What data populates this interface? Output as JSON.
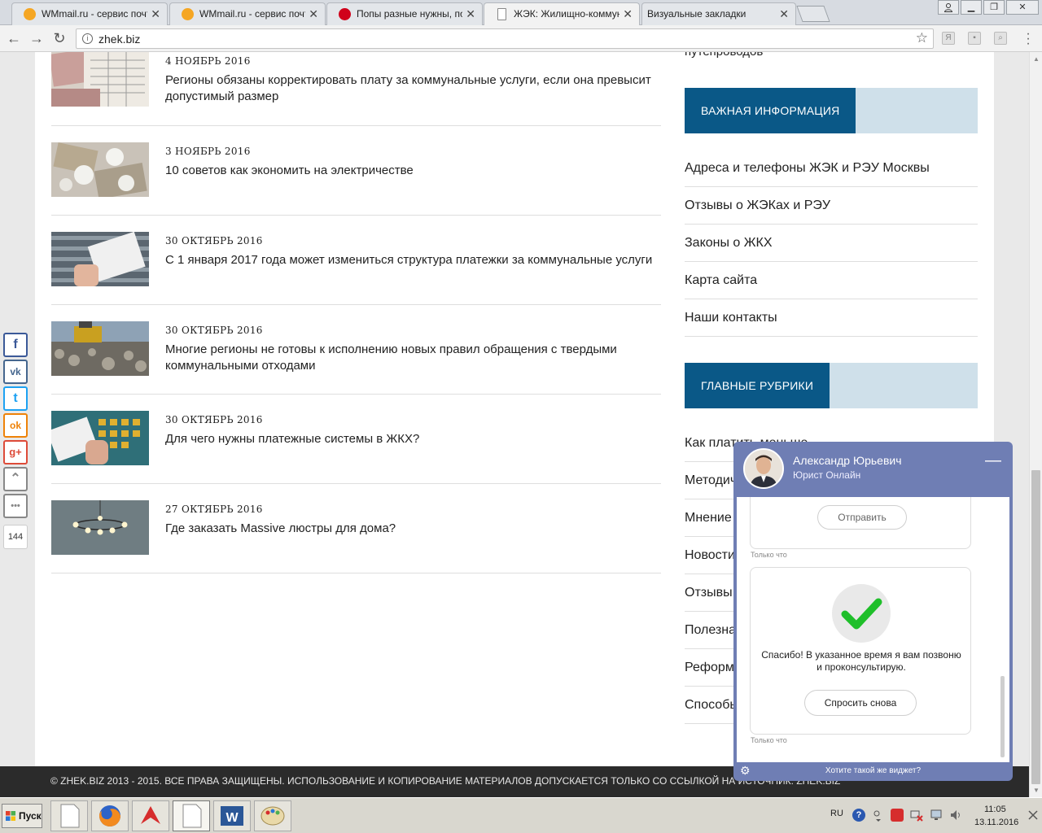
{
  "browser": {
    "tabs": [
      {
        "title": "WMmail.ru - сервис почтов",
        "favicon_color": "#f5a623"
      },
      {
        "title": "WMmail.ru - сервис почтов",
        "favicon_color": "#f5a623"
      },
      {
        "title": "Попы разные нужны, поп",
        "favicon_color": "#d0021b"
      },
      {
        "title": "ЖЭК: Жилищно-коммунал",
        "favicon_color": "#ffffff"
      },
      {
        "title": "Визуальные закладки",
        "favicon_color": "#e3e6ea"
      }
    ],
    "close_glyph": "✕",
    "url": "zhek.biz"
  },
  "news": [
    {
      "date": "4 НОЯБРЬ 2016",
      "title": "Регионы обязаны корректировать плату за коммунальные услуги, если она превысит допустимый размер"
    },
    {
      "date": "3 НОЯБРЬ 2016",
      "title": "10 советов как экономить на электричестве"
    },
    {
      "date": "30 ОКТЯБРЬ 2016",
      "title": "С 1 января 2017 года может измениться структура платежки за коммунальные услуги"
    },
    {
      "date": "30 ОКТЯБРЬ 2016",
      "title": "Многие регионы не готовы к исполнению новых правил обращения с твердыми коммунальными отходами"
    },
    {
      "date": "30 ОКТЯБРЬ 2016",
      "title": "Для чего нужны платежные системы в ЖКХ?"
    },
    {
      "date": "27 ОКТЯБРЬ 2016",
      "title": "Где заказать Massive люстры для дома?"
    }
  ],
  "sidebar": {
    "cut_text": "путепроводов",
    "important": {
      "heading": "ВАЖНАЯ ИНФОРМАЦИЯ",
      "links": [
        "Адреса и телефоны ЖЭК и РЭУ Москвы",
        "Отзывы о ЖЭКах и РЭУ",
        "Законы о ЖКХ",
        "Карта сайта",
        "Наши контакты"
      ]
    },
    "rubrics": {
      "heading": "ГЛАВНЫЕ РУБРИКИ",
      "links": [
        "Как платить меньше",
        "Методич",
        "Мнение",
        "Новости",
        "Отзывы",
        "Полезна",
        "Реформ",
        "Способы"
      ]
    }
  },
  "footer": {
    "text": "© ZHEK.BIZ 2013 - 2015. ВСЕ ПРАВА ЗАЩИЩЕНЫ. ИСПОЛЬЗОВАНИЕ И КОПИРОВАНИЕ МАТЕРИАЛОВ ДОПУСКАЕТСЯ ТОЛЬКО СО ССЫЛКОЙ НА ИСТОЧНИК: ZHEK.BIZ"
  },
  "share": {
    "buttons": [
      {
        "icon": "facebook-icon",
        "glyph": "f",
        "color": "#3b5998"
      },
      {
        "icon": "vk-icon",
        "glyph": "vk",
        "color": "#45668e"
      },
      {
        "icon": "twitter-icon",
        "glyph": "t",
        "color": "#1da1f2"
      },
      {
        "icon": "odnoklassniki-icon",
        "glyph": "ok",
        "color": "#ee8208"
      },
      {
        "icon": "google-plus-icon",
        "glyph": "g+",
        "color": "#dd4b39"
      },
      {
        "icon": "scroll-up-icon",
        "glyph": "⌃",
        "color": "#888888"
      },
      {
        "icon": "more-icon",
        "glyph": "•••",
        "color": "#888888"
      }
    ],
    "count": "144"
  },
  "chat": {
    "name": "Александр Юрьевич",
    "role": "Юрист Онлайн",
    "minimize_glyph": "—",
    "send_label": "Отправить",
    "stamp1": "Только что",
    "thanks": "Спасибо! В указанное время я вам позвоню и проконсультирую.",
    "ask_again_label": "Спросить снова",
    "stamp2": "Только что",
    "footer_link": "Хотите такой же виджет?",
    "accent": "#6f7eb4",
    "check_color": "#22bb22"
  },
  "taskbar": {
    "start_label": "Пуск",
    "lang": "RU",
    "time": "11:05",
    "date": "13.11.2016"
  }
}
